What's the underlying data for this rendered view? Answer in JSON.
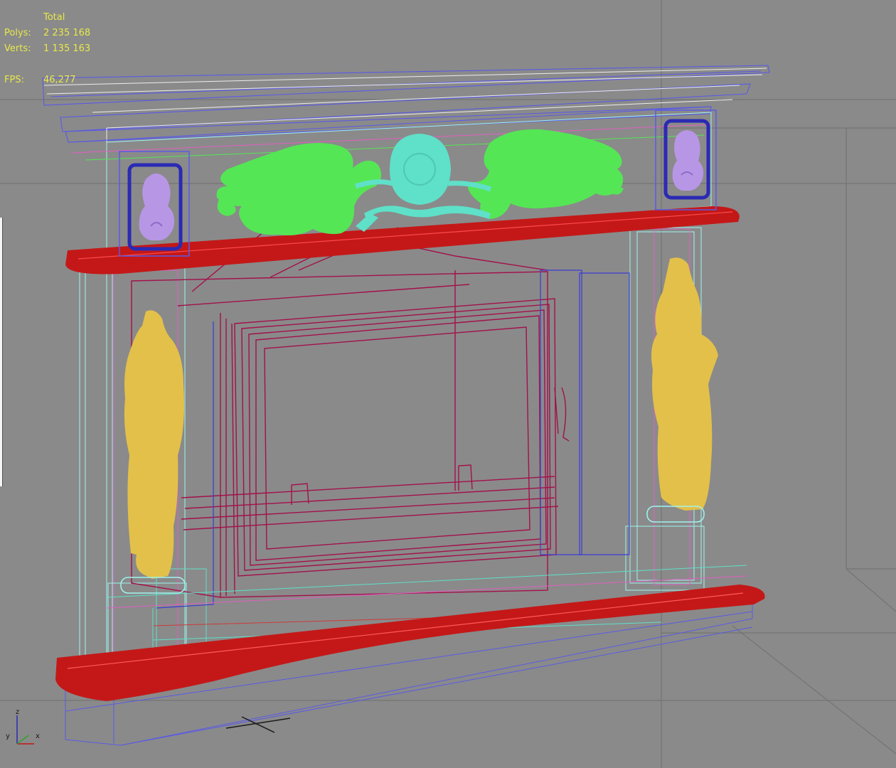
{
  "stats": {
    "header": "Total",
    "polys_label": "Polys:",
    "polys_value": "2 235 168",
    "verts_label": "Verts:",
    "verts_value": "1 135 163",
    "fps_label": "FPS:",
    "fps_value": "46,277"
  },
  "axis": {
    "z_label": "z",
    "y_label": "y",
    "x_label": "x"
  },
  "colors": {
    "background": "#8a8a8a",
    "grid": "#747474",
    "stats_text": "#e8e84a",
    "wire_blue": "#5a5ae6",
    "wire_cyan": "#9ff5ef",
    "wire_crimson": "#a3104a",
    "wire_pink": "#e060c0",
    "hearth_red": "#c41818",
    "carving_green": "#55e655",
    "medallion_teal": "#5fe0c8",
    "figure_yellow": "#e3c04a",
    "mask_lavender": "#b896e6",
    "frame_navy": "#2a2ab4"
  }
}
